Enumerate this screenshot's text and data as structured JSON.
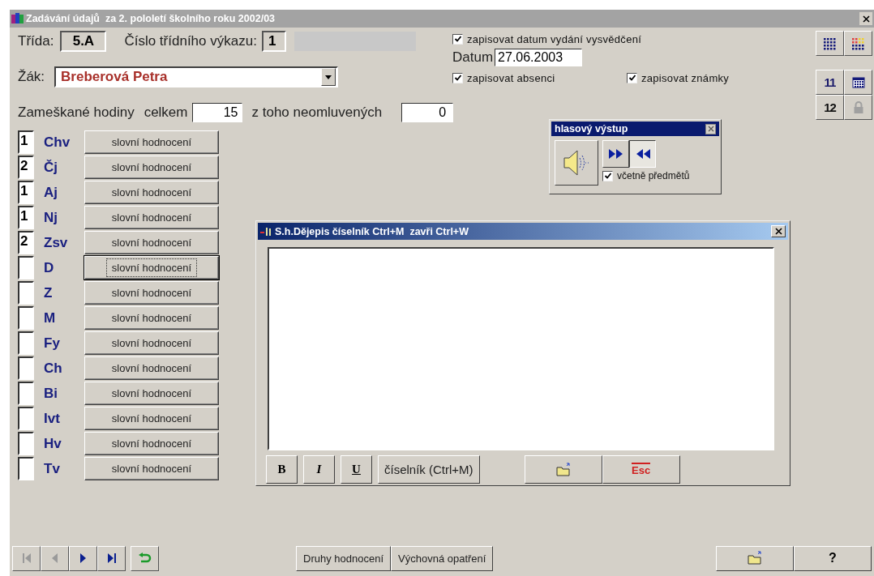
{
  "window": {
    "title": "Zadávání údajů  za 2. pololetí školního roku 2002/03"
  },
  "class": {
    "label": "Třída:",
    "value": "5.A"
  },
  "register": {
    "label": "Číslo třídního výkazu:",
    "value": "1"
  },
  "student": {
    "label": "Žák:",
    "value": "Breberová Petra"
  },
  "date_option": {
    "label": "zapisovat datum vydání vysvědčení",
    "checked": true
  },
  "date": {
    "label": "Datum",
    "value": "27.06.2003"
  },
  "absence_option": {
    "label": "zapisovat absenci",
    "checked": true
  },
  "grades_option": {
    "label": "zapisovat známky",
    "checked": true
  },
  "absences": {
    "label": "Zameškané hodiny",
    "total_label": "celkem",
    "total": "15",
    "unexcused_label": "z toho neomluvených",
    "unexcused": "0"
  },
  "side_buttons": [
    {
      "kind": "grid"
    },
    {
      "kind": "color-grid"
    },
    {
      "kind": "sort-up",
      "label": "11"
    },
    {
      "kind": "calendar"
    },
    {
      "kind": "sort-down",
      "label": "12"
    },
    {
      "kind": "lock"
    }
  ],
  "subjects": [
    {
      "grade": "1",
      "code": "Chv",
      "button": "slovní hodnocení",
      "focused": false
    },
    {
      "grade": "2",
      "code": "Čj",
      "button": "slovní hodnocení",
      "focused": false
    },
    {
      "grade": "1",
      "code": "Aj",
      "button": "slovní hodnocení",
      "focused": false
    },
    {
      "grade": "1",
      "code": "Nj",
      "button": "slovní hodnocení",
      "focused": false
    },
    {
      "grade": "2",
      "code": "Zsv",
      "button": "slovní hodnocení",
      "focused": false
    },
    {
      "code": "D",
      "button": "slovní hodnocení",
      "focused": true
    },
    {
      "code": "Z",
      "button": "slovní hodnocení",
      "focused": false
    },
    {
      "code": "M",
      "button": "slovní hodnocení",
      "focused": false
    },
    {
      "code": "Fy",
      "button": "slovní hodnocení",
      "focused": false
    },
    {
      "code": "Ch",
      "button": "slovní hodnocení",
      "focused": false
    },
    {
      "code": "Bi",
      "button": "slovní hodnocení",
      "focused": false
    },
    {
      "code": "Ivt",
      "button": "slovní hodnocení",
      "focused": false
    },
    {
      "code": "Hv",
      "button": "slovní hodnocení",
      "focused": false
    },
    {
      "code": "Tv",
      "button": "slovní hodnocení",
      "focused": false
    }
  ],
  "voice_output": {
    "title": "hlasový výstup",
    "buttons": [
      {
        "kind": "forward",
        "selected": false
      },
      {
        "kind": "rewind",
        "selected": true
      }
    ],
    "include_subjects": {
      "label": "včetně předmětů",
      "checked": true
    }
  },
  "editor": {
    "title": "S.h.Dějepis číselník Ctrl+M  zavři Ctrl+W",
    "format_buttons": [
      {
        "kind": "bold",
        "label": "B"
      },
      {
        "kind": "italic",
        "label": "I"
      },
      {
        "kind": "underline",
        "label": "U"
      }
    ],
    "lookup_button": "číselník (Ctrl+M)",
    "actions": [
      {
        "kind": "open"
      },
      {
        "kind": "escape",
        "label": "Esc"
      }
    ]
  },
  "navigation": [
    {
      "kind": "first",
      "disabled": true
    },
    {
      "kind": "prev",
      "disabled": true
    },
    {
      "kind": "next",
      "disabled": false
    },
    {
      "kind": "last",
      "disabled": false
    },
    {
      "kind": "return",
      "disabled": false
    }
  ],
  "footer_buttons": [
    "Druhy hodnocení",
    "Výchovná opatření"
  ],
  "footer_actions": [
    {
      "kind": "open"
    },
    {
      "kind": "help",
      "label": "?"
    }
  ]
}
